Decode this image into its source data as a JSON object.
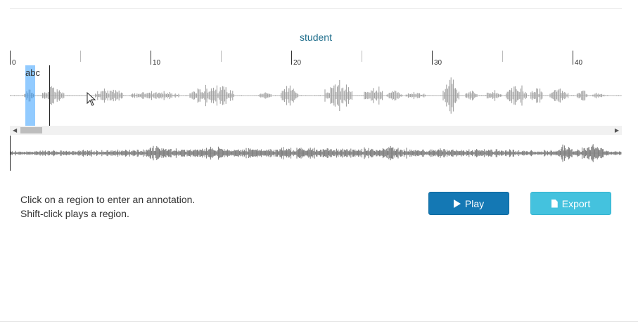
{
  "track": {
    "title": "student"
  },
  "timeline": {
    "labels": [
      "0",
      "10",
      "20",
      "30",
      "40"
    ]
  },
  "region": {
    "label": "abc",
    "color": "#38a0ff"
  },
  "instructions": {
    "line1": "Click on a region to enter an annotation.",
    "line2": "Shift-click plays a region."
  },
  "buttons": {
    "play_label": "Play",
    "play_icon": "play-icon",
    "play_color": "#1478b4",
    "export_label": "Export",
    "export_icon": "file-icon",
    "export_color": "#44c2de"
  },
  "colors": {
    "waveform": "#9a9a9a",
    "minimap_wave": "#777777",
    "title": "#1f6e8c"
  }
}
